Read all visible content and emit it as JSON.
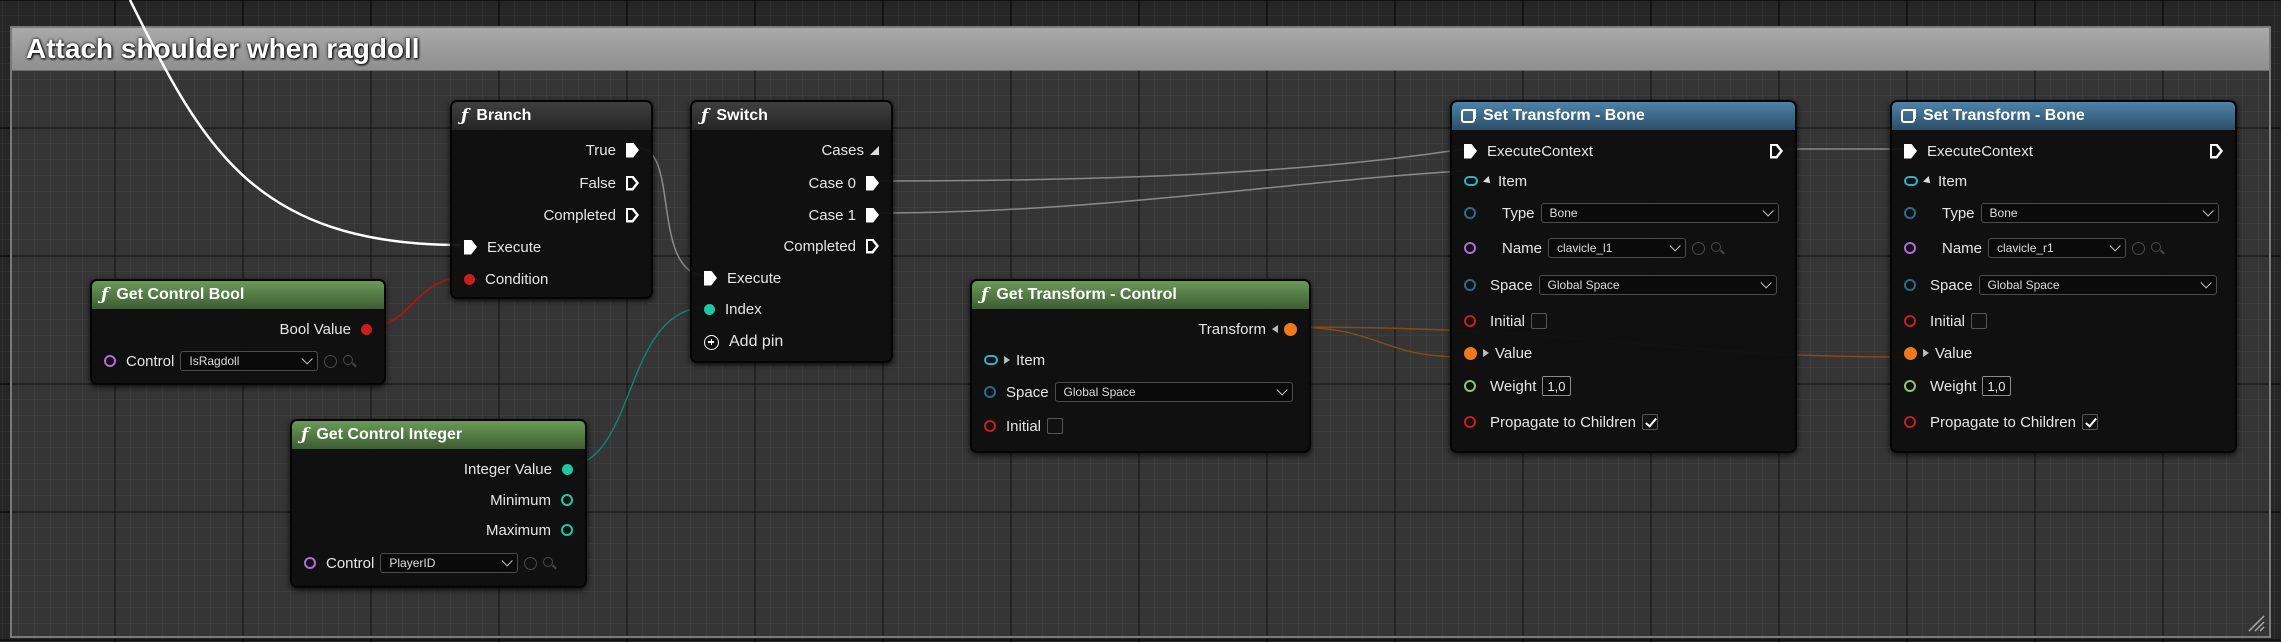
{
  "comment": {
    "title": "Attach shoulder when ragdoll"
  },
  "colors": {
    "exec": "#ffffff",
    "bool": "#c81e1e",
    "integer": "#1dc7a5",
    "transform": "#ef7a1e",
    "name": "#b06cd8",
    "enum": "#2c6a8c",
    "struct_item": "#2bb2cc",
    "float": "#8ec56a"
  },
  "get_control_bool": {
    "title": "Get Control Bool",
    "output": "Bool Value",
    "control_label": "Control",
    "control_value": "IsRagdoll"
  },
  "get_control_integer": {
    "title": "Get Control Integer",
    "outputs": [
      "Integer Value",
      "Minimum",
      "Maximum"
    ],
    "control_label": "Control",
    "control_value": "PlayerID"
  },
  "branch": {
    "title": "Branch",
    "outputs": [
      "True",
      "False",
      "Completed"
    ],
    "inputs": [
      "Execute",
      "Condition"
    ]
  },
  "switch": {
    "title": "Switch",
    "outputs": [
      "Cases",
      "Case 0",
      "Case 1",
      "Completed"
    ],
    "inputs": [
      "Execute",
      "Index"
    ],
    "add_pin": "Add pin"
  },
  "get_transform_control": {
    "title": "Get Transform - Control",
    "output": "Transform",
    "item": "Item",
    "space_label": "Space",
    "space_value": "Global Space",
    "initial": "Initial"
  },
  "set_transform_1": {
    "title": "Set Transform - Bone",
    "execute_context": "ExecuteContext",
    "item": "Item",
    "type_label": "Type",
    "type_value": "Bone",
    "name_label": "Name",
    "name_value": "clavicle_l1",
    "space_label": "Space",
    "space_value": "Global Space",
    "initial": "Initial",
    "value": "Value",
    "weight_label": "Weight",
    "weight_value": "1,0",
    "propagate": "Propagate to Children"
  },
  "set_transform_2": {
    "title": "Set Transform - Bone",
    "execute_context": "ExecuteContext",
    "item": "Item",
    "type_label": "Type",
    "type_value": "Bone",
    "name_label": "Name",
    "name_value": "clavicle_r1",
    "space_label": "Space",
    "space_value": "Global Space",
    "initial": "Initial",
    "value": "Value",
    "weight_label": "Weight",
    "weight_value": "1,0",
    "propagate": "Propagate to Children"
  }
}
